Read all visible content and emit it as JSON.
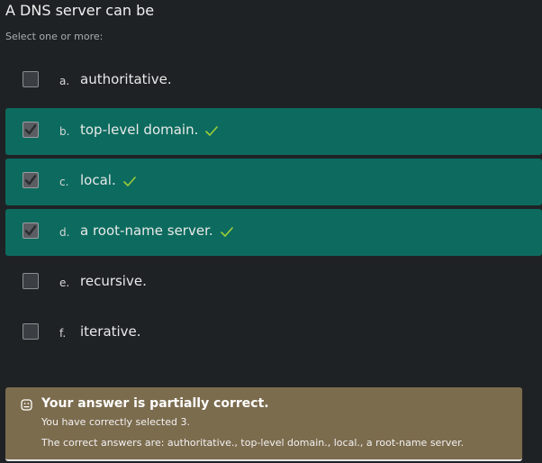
{
  "question": {
    "title": "A DNS server can be",
    "hint": "Select one or more:"
  },
  "options": [
    {
      "letter": "a.",
      "text": "authoritative.",
      "checked": false,
      "correct": false
    },
    {
      "letter": "b.",
      "text": "top-level domain.",
      "checked": true,
      "correct": true
    },
    {
      "letter": "c.",
      "text": "local.",
      "checked": true,
      "correct": true
    },
    {
      "letter": "d.",
      "text": "a root-name server.",
      "checked": true,
      "correct": true
    },
    {
      "letter": "e.",
      "text": "recursive.",
      "checked": false,
      "correct": false
    },
    {
      "letter": "f.",
      "text": "iterative.",
      "checked": false,
      "correct": false
    }
  ],
  "feedback": {
    "icon": "partial-icon",
    "title": "Your answer is partially correct.",
    "line1": "You have correctly selected 3.",
    "line2": "The correct answers are: authoritative., top-level domain., local., a root-name server."
  },
  "colors": {
    "background": "#1f2225",
    "correct_row": "#0c6b5e",
    "feedback_bg": "#7c6c4e",
    "tick": "#9ccc3a"
  }
}
